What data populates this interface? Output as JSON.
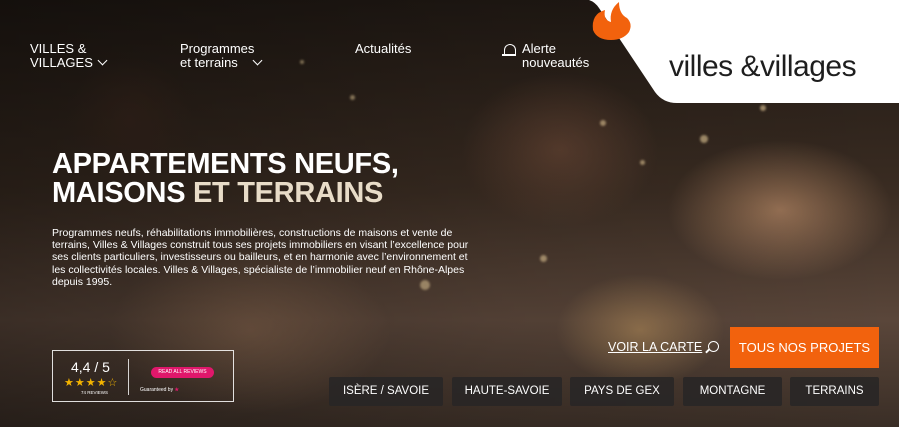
{
  "nav": {
    "items": [
      {
        "line1": "VILLES &",
        "line2": "VILLAGES",
        "has_chevron": true
      },
      {
        "line1": "Programmes",
        "line2": "et terrains",
        "has_chevron": true
      },
      {
        "line1": "Actualités",
        "line2": "",
        "has_chevron": false
      },
      {
        "line1": "Alerte",
        "line2": "nouveautés",
        "icon": "bell-icon"
      }
    ]
  },
  "logo": {
    "text": "villes &villages",
    "brand_color": "#f2620d"
  },
  "hero": {
    "headline_line1": "APPARTEMENTS NEUFS,",
    "headline_line2_main": "MAISONS",
    "headline_line2_accent": " ET TERRAINS",
    "description": "Programmes neufs, réhabilitations immobilières, constructions de maisons et vente de terrains, Villes & Villages construit tous ses projets immobiliers en visant l’excellence pour ses clients particuliers, investisseurs ou bailleurs, et en harmonie avec l’environnement et les collectivités locales. Villes & Villages, spécialiste de l’immobilier neuf en Rhône-Alpes depuis 1995."
  },
  "rating": {
    "score": "4,4 / 5",
    "stars": "★★★★☆",
    "count": "74 REVIEWS",
    "read_all": "READ ALL REVIEWS",
    "guaranteed": "Guaranteed by",
    "guaranteed_mark": "★"
  },
  "map_link": {
    "label": "VOIR LA CARTE",
    "icon": "search-icon"
  },
  "cta": {
    "label": "TOUS NOS PROJETS",
    "color": "#f2620d"
  },
  "regions": [
    "ISÈRE / SAVOIE",
    "HAUTE-SAVOIE",
    "PAYS DE GEX",
    "MONTAGNE",
    "TERRAINS"
  ]
}
